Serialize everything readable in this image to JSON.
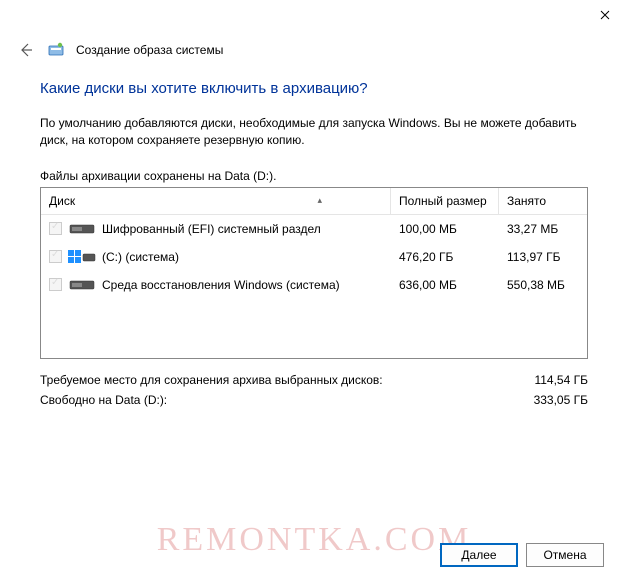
{
  "window": {
    "title": "Создание образа системы"
  },
  "heading": "Какие диски вы хотите включить в архивацию?",
  "description": "По умолчанию добавляются диски, необходимые для запуска Windows. Вы не можете добавить диск, на котором сохраняете резервную копию.",
  "storage_label": "Файлы архивации сохранены на Data (D:).",
  "columns": {
    "disk": "Диск",
    "size": "Полный размер",
    "used": "Занято"
  },
  "rows": [
    {
      "name": "Шифрованный (EFI) системный раздел",
      "size": "100,00 МБ",
      "used": "33,27 МБ",
      "kind": "partition"
    },
    {
      "name": "(C:) (система)",
      "size": "476,20 ГБ",
      "used": "113,97 ГБ",
      "kind": "system"
    },
    {
      "name": "Среда восстановления Windows (система)",
      "size": "636,00 МБ",
      "used": "550,38 МБ",
      "kind": "partition"
    }
  ],
  "summary": {
    "required_label": "Требуемое место для сохранения архива выбранных дисков:",
    "required_value": "114,54 ГБ",
    "free_label": "Свободно на Data (D:):",
    "free_value": "333,05 ГБ"
  },
  "buttons": {
    "next": "Далее",
    "cancel": "Отмена"
  },
  "watermark": "REMONTKA.COM"
}
